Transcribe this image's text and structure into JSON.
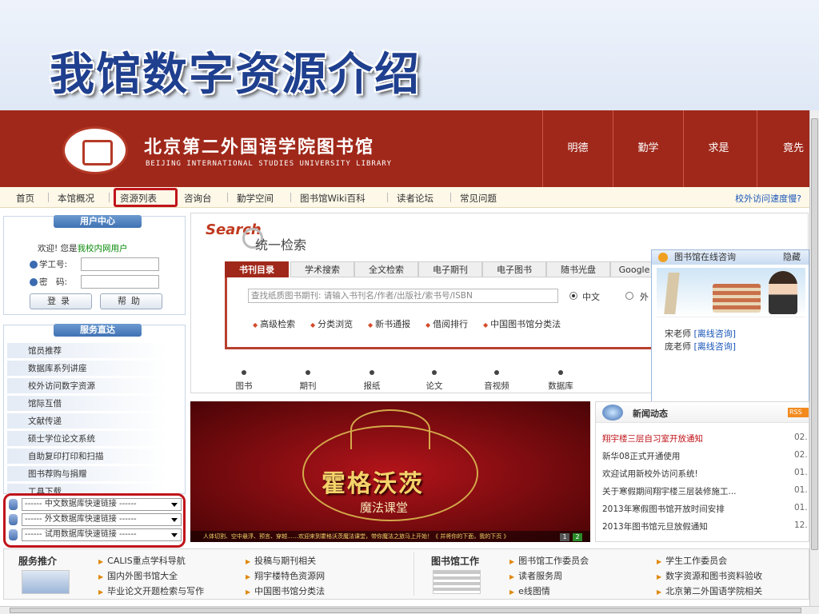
{
  "slide": {
    "title": "我馆数字资源介绍"
  },
  "banner": {
    "name_cn": "北京第二外国语学院图书馆",
    "name_en": "BEIJING INTERNATIONAL STUDIES UNIVERSITY LIBRARY",
    "motto": [
      "明德",
      "勤学",
      "求是",
      "竟先"
    ]
  },
  "nav": {
    "items": [
      "首页",
      "本馆概况",
      "资源列表",
      "咨询台",
      "勤学空间",
      "图书馆Wiki百科",
      "读者论坛",
      "常见问题"
    ],
    "right": "校外访问速度慢?"
  },
  "user_center": {
    "title": "用户中心",
    "welcome_prefix": "欢迎! 您是",
    "welcome_user": "我校内网用户",
    "id_label": "学工号:",
    "pwd_label": "密　码:",
    "login": "登录",
    "help": "帮助"
  },
  "services": {
    "title": "服务直达",
    "items": [
      "馆员推荐",
      "数据库系列讲座",
      "校外访问数字资源",
      "馆际互借",
      "文献传递",
      "硕士学位论文系统",
      "自助复印打印和扫描",
      "图书荐购与捐赠",
      "工具下载"
    ]
  },
  "quick_links": [
    "------ 中文数据库快速链接 ------",
    "------ 外文数据库快速链接 ------",
    "------ 试用数据库快速链接 ------"
  ],
  "search": {
    "logo": "Search",
    "subtitle": "统一检索",
    "tabs": [
      "书刊目录",
      "学术搜索",
      "全文检索",
      "电子期刊",
      "电子图书",
      "随书光盘",
      "Google"
    ],
    "placeholder": "查找纸质图书期刊: 请输入书刊名/作者/出版社/索书号/ISBN",
    "lang_cn": "中文",
    "lang_other": "外",
    "advanced": [
      "高级检索",
      "分类浏览",
      "新书通报",
      "借阅排行",
      "中国图书馆分类法"
    ],
    "categories": [
      "图书",
      "期刊",
      "报纸",
      "论文",
      "音视频",
      "数据库"
    ]
  },
  "chat": {
    "title": "图书馆在线咨询",
    "hide": "隐藏",
    "lines": [
      {
        "name": "宋老师",
        "status": "[离线咨询]"
      },
      {
        "name": "庞老师",
        "status": "[离线咨询]"
      }
    ]
  },
  "promo": {
    "title": "霍格沃茨",
    "subtitle": "魔法课堂",
    "strip": "人体切割、空中悬浮、预言、穿越……欢迎来到霍格沃茨魔法课堂，带你魔法之旅马上开始！《 并将你的下面，我的下页 》",
    "pages": [
      "1",
      "2"
    ]
  },
  "news": {
    "title": "新闻动态",
    "rss": "RSS",
    "items": [
      {
        "title": "翔宇楼三层自习室开放通知",
        "date": "02.",
        "highlight": true
      },
      {
        "title": "新华08正式开通使用",
        "date": "02."
      },
      {
        "title": "欢迎试用新校外访问系统!",
        "date": "01."
      },
      {
        "title": "关于寒假期间翔宇楼三层装修施工...",
        "date": "01."
      },
      {
        "title": "2013年寒假图书馆开放时间安排",
        "date": "01."
      },
      {
        "title": "2013年图书馆元旦放假通知",
        "date": "12."
      }
    ]
  },
  "bottom": {
    "service_title": "服务推介",
    "service_links": [
      "CALIS重点学科导航",
      "国内外图书馆大全",
      "毕业论文开题检索与写作",
      "投稿与期刊相关",
      "翔宇楼特色资源网",
      "中国图书馆分类法"
    ],
    "work_title": "图书馆工作",
    "work_links": [
      "图书馆工作委员会",
      "读者服务周",
      "e线图情",
      "学生工作委员会",
      "数字资源和图书资料验收",
      "北京第二外国语学院相关"
    ]
  },
  "colors": {
    "brand": "#a0281a",
    "link": "#1a56b8",
    "highlight": "#c0141a"
  }
}
